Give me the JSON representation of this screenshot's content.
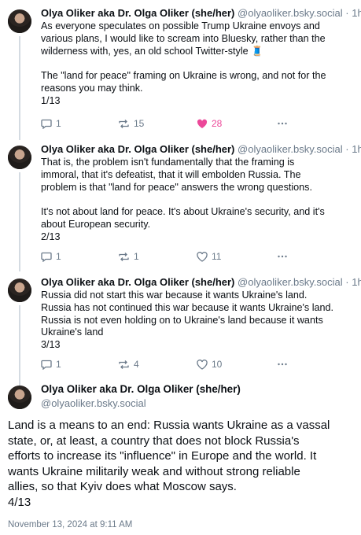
{
  "posts": [
    {
      "author": "Olya Oliker aka Dr. Olga Oliker (she/her)",
      "handle": "@olyaoliker.bsky.social",
      "age": "1h",
      "lines": [
        "As everyone speculates on possible Trump Ukraine envoys and",
        "various plans, I would like to scream into Bluesky, rather than the",
        "wilderness with, yes, an old school Twitter-style 🧵",
        "",
        "The \"land for peace\" framing on Ukraine is wrong, and not for the",
        "reasons you may think.",
        "1/13"
      ],
      "replies": "1",
      "reposts": "15",
      "likes": "28",
      "liked": true
    },
    {
      "author": "Olya Oliker aka Dr. Olga Oliker (she/her)",
      "handle": "@olyaoliker.bsky.social",
      "age": "1h",
      "lines": [
        "That is, the problem isn't fundamentally that the framing is",
        "immoral, that it's defeatist, that it will embolden Russia. The",
        "problem is that \"land for peace\" answers the wrong questions.",
        "",
        "It's not about land for peace. It's about Ukraine's security, and it's",
        "about European security.",
        "2/13"
      ],
      "replies": "1",
      "reposts": "1",
      "likes": "11",
      "liked": false
    },
    {
      "author": "Olya Oliker aka Dr. Olga Oliker (she/her)",
      "handle": "@olyaoliker.bsky.social",
      "age": "1h",
      "lines": [
        "Russia did not start this war because it wants Ukraine's land.",
        "Russia has not continued this war because it wants Ukraine's land.",
        "Russia is not even holding on to Ukraine's land because it wants",
        "Ukraine's land",
        "3/13"
      ],
      "replies": "1",
      "reposts": "4",
      "likes": "10",
      "liked": false
    }
  ],
  "main_post": {
    "author": "Olya Oliker aka Dr. Olga Oliker (she/her)",
    "handle": "@olyaoliker.bsky.social",
    "lines": [
      "Land is a means to an end: Russia wants Ukraine as a vassal",
      "state, or, at least, a country that does not block Russia's",
      "efforts to increase its \"influence\" in Europe and the world. It",
      "wants Ukraine militarily weak and without strong reliable",
      "allies, so that Kyiv does what Moscow says.",
      "4/13"
    ],
    "timestamp": "November 13, 2024 at 9:11 AM"
  },
  "separator": "·",
  "colors": {
    "muted": "#6b7a8a",
    "like": "#ec4899",
    "thread": "#d4dbe2"
  },
  "icons": [
    "reply-icon",
    "repost-icon",
    "like-icon",
    "more-icon"
  ]
}
